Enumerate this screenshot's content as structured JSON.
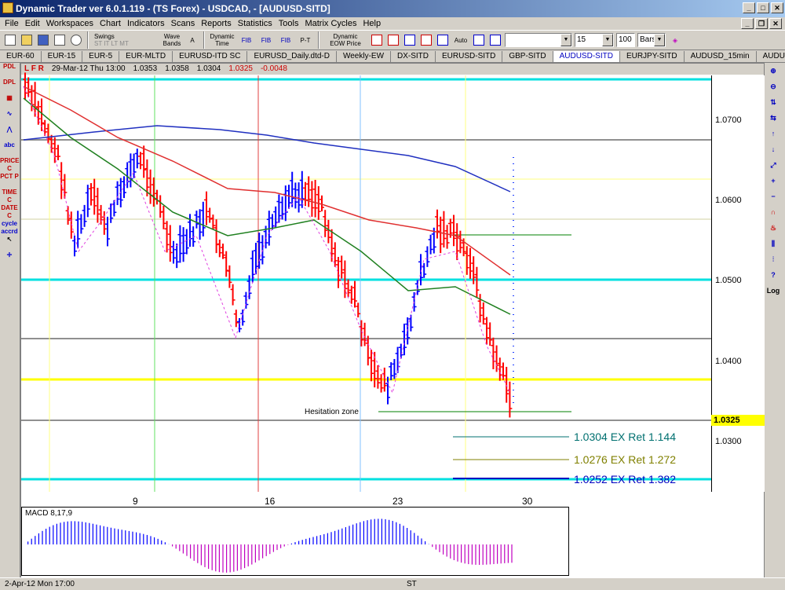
{
  "window": {
    "title": "Dynamic Trader ver 6.0.1.119 - (TS Forex) - USDCAD, - [AUDUSD-SITD]"
  },
  "menu": [
    "File",
    "Edit",
    "Workspaces",
    "Chart",
    "Indicators",
    "Scans",
    "Reports",
    "Statistics",
    "Tools",
    "Matrix Cycles",
    "Help"
  ],
  "toolbar": {
    "swings_label": "Swings",
    "swings_sub": "ST IT LT MT",
    "wave_label": "Wave Bands",
    "dyn_time": "Dynamic Time",
    "fib": "FIB",
    "pt": "P-T",
    "dyn_eow": "Dynamic EOW Price",
    "auto": "Auto",
    "bars_value": "15",
    "count_value": "100",
    "bars_type": "Bars"
  },
  "tabs": [
    "EUR-60",
    "EUR-15",
    "EUR-5",
    "EUR-MLTD",
    "EURUSD-ITD SC",
    "EURUSD_Daily.dtd-D",
    "Weekly-EW",
    "DX-SITD",
    "EURUSD-SITD",
    "GBP-SITD",
    "AUDUSD-SITD",
    "EURJPY-SITD",
    "AUDUSD_15min",
    "AUDUSD-ITD"
  ],
  "active_tab": "AUDUSD-SITD",
  "left_tools": [
    "PDL",
    "DPL",
    "abc",
    "PRICE C",
    "PCT P",
    "TIME C",
    "DATE C",
    "cycle accrd"
  ],
  "info_bar": {
    "modes": "L  F  R",
    "date": "29-Mar-12 Thu 13:00",
    "open": "1.0353",
    "high": "1.0358",
    "low": "1.0304",
    "close": "1.0325",
    "change": "-0.0048"
  },
  "price_axis": [
    "1.0700",
    "1.0600",
    "1.0500",
    "1.0400",
    "1.0300"
  ],
  "current_price": "1.0325",
  "date_axis": [
    "9",
    "16",
    "23",
    "30"
  ],
  "annotations": {
    "hesitation": "Hesitation zone",
    "targets": [
      {
        "text": "1.0304 EX Ret 1.144",
        "color": "#007070"
      },
      {
        "text": "1.0276 EX Ret 1.272",
        "color": "#808000"
      },
      {
        "text": "1.0252 EX Ret 1.382",
        "color": "#0000c0"
      }
    ]
  },
  "macd_label": "MACD 8,17,9",
  "status": {
    "date": "2-Apr-12 Mon 17:00",
    "mode": "ST"
  },
  "colors": {
    "up": "#0000ff",
    "down": "#ff0000",
    "cyan": "#00e0e0",
    "yellow": "#ffff00",
    "gray": "#909090"
  }
}
